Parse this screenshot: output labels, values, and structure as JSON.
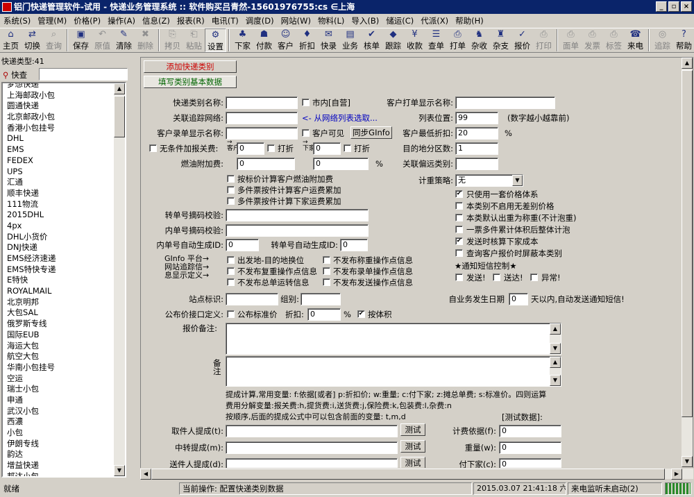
{
  "window": {
    "title": "铝门快递管理软件-试用  - 快递业务管理系统  ::  软件购买吕青然-15601976755:cs  ∈上海",
    "min": "_",
    "restore": "▫",
    "close": "×"
  },
  "menu": [
    "系统(S)",
    "管理(M)",
    "价格(P)",
    "操作(A)",
    "信息(Z)",
    "报表(R)",
    "电讯(T)",
    "调度(D)",
    "网站(W)",
    "物料(L)",
    "导入(B)",
    "储运(C)",
    "代派(X)",
    "帮助(H)"
  ],
  "toolbar": [
    {
      "label": "主页",
      "icon": "⌂",
      "enabled": true
    },
    {
      "label": "切换",
      "icon": "⇄",
      "enabled": true
    },
    {
      "label": "查询",
      "icon": "⌕",
      "enabled": false
    },
    {
      "label": "保存",
      "icon": "▣",
      "enabled": true
    },
    {
      "label": "原值",
      "icon": "↶",
      "enabled": false
    },
    {
      "label": "清除",
      "icon": "✎",
      "enabled": true
    },
    {
      "label": "删除",
      "icon": "✖",
      "enabled": false
    },
    {
      "label": "拷贝",
      "icon": "⎘",
      "enabled": false
    },
    {
      "label": "粘贴",
      "icon": "⎗",
      "enabled": false
    },
    {
      "label": "设置",
      "icon": "⚙",
      "enabled": true,
      "pressed": true
    },
    {
      "label": "下家",
      "icon": "♣",
      "enabled": true
    },
    {
      "label": "付款",
      "icon": "☗",
      "enabled": true
    },
    {
      "label": "客户",
      "icon": "☺",
      "enabled": true
    },
    {
      "label": "折扣",
      "icon": "♦",
      "enabled": true
    },
    {
      "label": "快录",
      "icon": "✉",
      "enabled": true
    },
    {
      "label": "业务",
      "icon": "▤",
      "enabled": true
    },
    {
      "label": "核单",
      "icon": "✔",
      "enabled": true
    },
    {
      "label": "跟踪",
      "icon": "◆",
      "enabled": true
    },
    {
      "label": "收款",
      "icon": "¥",
      "enabled": true
    },
    {
      "label": "查单",
      "icon": "☰",
      "enabled": true
    },
    {
      "label": "打单",
      "icon": "⎙",
      "enabled": true
    },
    {
      "label": "杂收",
      "icon": "♞",
      "enabled": true
    },
    {
      "label": "杂支",
      "icon": "♜",
      "enabled": true
    },
    {
      "label": "报价",
      "icon": "✓",
      "enabled": true
    },
    {
      "label": "打印",
      "icon": "⎙",
      "enabled": false
    },
    {
      "label": "面单",
      "icon": "⎙",
      "enabled": false
    },
    {
      "label": "发票",
      "icon": "⎙",
      "enabled": false
    },
    {
      "label": "标签",
      "icon": "⎙",
      "enabled": false
    },
    {
      "label": "来电",
      "icon": "☎",
      "enabled": true
    },
    {
      "label": "追踪",
      "icon": "◎",
      "enabled": false
    },
    {
      "label": "帮助",
      "icon": "?",
      "enabled": true
    }
  ],
  "left": {
    "count_label": "快递类型:41",
    "quick_label": "快查",
    "quick_value": "",
    "items": [
      "梦想快递",
      "上海邮政小包",
      "圆通快递",
      "北京邮政小包",
      "香港小包挂号",
      "DHL",
      "EMS",
      "FEDEX",
      "UPS",
      "汇通",
      "顺丰快递",
      "111物流",
      "2015DHL",
      "4px",
      "DHL小货价",
      "DNJ快递",
      "EMS经济速递",
      "EMS特快专递",
      "E特快",
      "ROYALMAIL",
      "北京明邦",
      "大包SAL",
      "俄罗斯专线",
      "国际EUB",
      "海运大包",
      "航空大包",
      "华南小包挂号",
      "空运",
      "瑞士小包",
      "申通",
      "武汉小包",
      "西濃",
      "小包",
      "伊朗专线",
      "韵达",
      "增益快递",
      "邦达小包"
    ]
  },
  "tabs": {
    "add": "添加快递类别",
    "basic": "填写类别基本数据"
  },
  "form": {
    "name_label": "快递类别名称:",
    "name_value": "",
    "city_label": "市内[自营]",
    "print_name_label": "客户打单显示名称:",
    "print_name_value": "",
    "track_label": "关联追踪网络:",
    "track_value": "",
    "track_link": "<- 从网络列表选取...",
    "pos_label": "列表位置:",
    "pos_value": "99",
    "pos_hint": "(数字越小越靠前)",
    "entry_name_label": "客户录单显示名称:",
    "entry_name_value": "",
    "cust_visible_label": "客户可见",
    "sync_button": "同步GInfo",
    "min_discount_label": "客户最低折扣:",
    "min_discount_value": "20",
    "percent": "%",
    "nocond_label": "无条件加报关费:",
    "cust_short": "客户",
    "next_short": "下家",
    "fee_cust_value": "0",
    "discount_label": "打折",
    "fee_next_value": "0",
    "zones_label": "目的地分区数:",
    "zones_value": "1",
    "fuel_label": "燃油附加费:",
    "fuel_cust_value": "0",
    "fuel_next_value": "0",
    "remote_label": "关联偏远类别:",
    "remote_value": "",
    "chk_fuel_by_price": "按标价计算客户燃油附加费",
    "chk_multi_cust": "多件票按件计算客户运费累加",
    "chk_multi_next": "多件票按件计算下家运费累加",
    "weight_policy_label": "计重策略:",
    "weight_policy_value": "无",
    "opt1": "只使用一套价格体系",
    "opt2": "本类别不启用无差别价格",
    "opt3": "本类默认出重为称重(不计泡重)",
    "opt4": "一票多件累计体积后整体计泡",
    "opt5": "发送时核算下家成本",
    "opt6": "查询客户报价时屏蔽本类别",
    "sms_title": "★通知短信控制★",
    "sms_send": "发送!",
    "sms_delivered": "送达!",
    "sms_error": "异常!",
    "transfer_check_label": "转单号摘码校验:",
    "transfer_check_value": "",
    "inner_check_label": "内单号摘码校验:",
    "inner_check_value": "",
    "inner_auto_label": "内单号自动生成ID:",
    "inner_auto_value": "0",
    "transfer_auto_label": "转单号自动生成ID:",
    "transfer_auto_value": "0",
    "ginfo_label": "GInfo 平台→\n网站追踪信→\n息显示定义→",
    "g1": "出发地-目的地换位",
    "g2": "不发布称重操作点信息",
    "g3": "不发布复重操作点信息",
    "g4": "不发布录单操作点信息",
    "g5": "不发布总单运转信息",
    "g6": "不发布发送操作点信息",
    "site_label": "站点标识:",
    "site_value": "",
    "group_label": "组别:",
    "group_value": "",
    "biz_date_label": "自业务发生日期",
    "biz_date_value": "0",
    "biz_date_hint": "天以内,自动发送通知短信!",
    "public_label": "公布价接口定义:",
    "public_std": "公布标准价",
    "public_discount_label": "折扣:",
    "public_discount_value": "0",
    "by_volume": "按体积",
    "quote_note_label": "报价备注:",
    "note_label": "备\n注",
    "help1": "提成计算,常用变量: f:依据[或者] p:折扣价; w:重量; c:付下家; z:摊总单费; s:标准价。四则运算",
    "help2": "费用分解变量:报关费:h,提货费:i,送货费:j,保险费:k,包装费:l,杂费:n",
    "help3": "按顺序,后面的提成公式中可以包含前面的变量: t,m,d",
    "test_data": "[测试数据]:",
    "pickup_label": "取件人提成(t):",
    "transfer_label": "中转提成(m):",
    "delivery_label": "送件人提成(d):",
    "test_button": "测试",
    "fee_basis_label": "计费依据(f):",
    "fee_basis_value": "0",
    "weight_label": "重量(w):",
    "weight_value": "0",
    "pay_next_label": "付下家(c):",
    "pay_next_value": "0"
  },
  "status": {
    "ready": "就绪",
    "current_op": "当前操作: 配置快递类别数据",
    "datetime": "2015.03.07  21:41:18 六",
    "call_monitor": "来电监听未启动(2)"
  }
}
